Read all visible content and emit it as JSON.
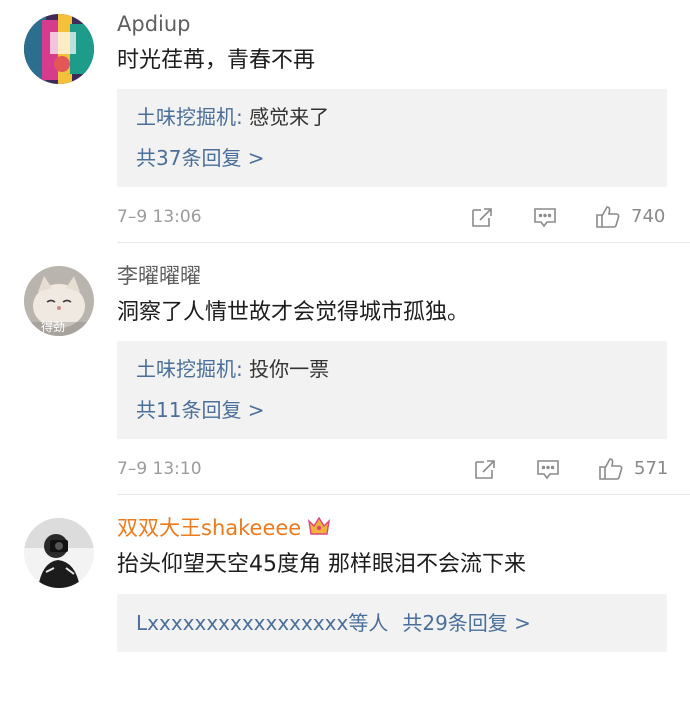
{
  "comments": [
    {
      "username": "Apdiup",
      "text": "时光荏苒，青春不再",
      "reply": {
        "author": "土味挖掘机",
        "separator": ": ",
        "content": "感觉来了",
        "count_label": "共37条回复 >"
      },
      "time": "7–9 13:06",
      "likes": "740",
      "avatar": "avatar-colorful"
    },
    {
      "username": "李曜曜曜",
      "text": "洞察了人情世故才会觉得城市孤独。",
      "reply": {
        "author": "土味挖掘机",
        "separator": ": ",
        "content": "投你一票",
        "count_label": "共11条回复 >"
      },
      "time": "7–9 13:10",
      "likes": "571",
      "avatar": "avatar-cat",
      "avatar_text": "得劲"
    },
    {
      "username": "双双大王shakeeee",
      "text": "抬头仰望天空45度角 那样眼泪不会流下来",
      "reply_summary": {
        "users": "Lxxxxxxxxxxxxxxxxx等人",
        "count_label": "共29条回复 >"
      },
      "avatar": "avatar-photographer"
    }
  ],
  "colors": {
    "link": "#4a6f9b",
    "vip_name": "#ed7a1c",
    "meta": "#9b9b9b"
  }
}
